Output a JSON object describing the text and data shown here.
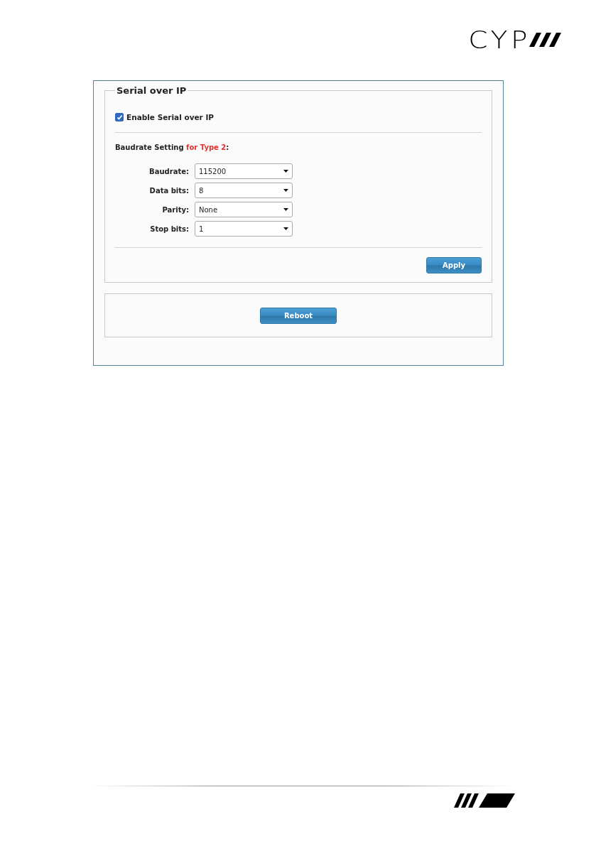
{
  "logo": {
    "text": "CYP"
  },
  "panel": {
    "legend": "Serial over IP",
    "enable": {
      "label": "Enable Serial over IP",
      "checked": true
    },
    "heading": {
      "text": "Baudrate Setting",
      "highlight": "for Type 2",
      "suffix": ":"
    },
    "fields": [
      {
        "label": "Baudrate:",
        "value": "115200"
      },
      {
        "label": "Data bits:",
        "value": "8"
      },
      {
        "label": "Parity:",
        "value": "None"
      },
      {
        "label": "Stop bits:",
        "value": "1"
      }
    ],
    "apply_button": "Apply"
  },
  "reboot_button": "Reboot"
}
